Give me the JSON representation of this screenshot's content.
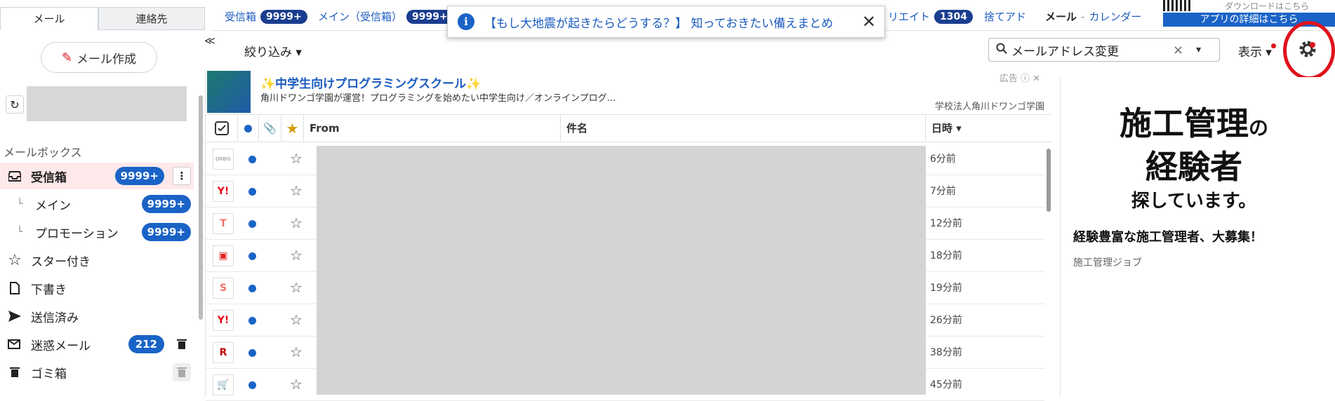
{
  "sidebar": {
    "tab_mail": "メール",
    "tab_contacts": "連絡先",
    "compose_label": "メール作成",
    "collapse_glyph": "≪",
    "mailbox_heading": "メールボックス",
    "folders": [
      {
        "label": "受信箱",
        "badge": "9999+"
      },
      {
        "label": "メイン",
        "badge": "9999+"
      },
      {
        "label": "プロモーション",
        "badge": "9999+"
      },
      {
        "label": "スター付き"
      },
      {
        "label": "下書き"
      },
      {
        "label": "送信済み"
      },
      {
        "label": "迷惑メール",
        "badge": "212"
      },
      {
        "label": "ゴミ箱"
      }
    ]
  },
  "topbar": {
    "tabs": [
      {
        "label": "受信箱",
        "badge": "9999+"
      },
      {
        "label": "メイン（受信箱）",
        "badge": "9999+"
      },
      {
        "label": "リエイト",
        "badge": "1304"
      },
      {
        "label": "捨てアド"
      }
    ],
    "app_mail": "メール",
    "app_separator": " - ",
    "app_calendar": "カレンダー",
    "app_banner": "アプリの詳細はこちら",
    "app_top_text": "ダウンロードはこちら"
  },
  "notice": {
    "text": "【もし大地震が起きたらどうする？】 知っておきたい備えまとめ",
    "close": "✕"
  },
  "toolbar": {
    "filter_label": "絞り込み ▾",
    "search_value": "メールアドレス変更",
    "search_clear": "×",
    "search_dropdown": "▾",
    "display_label": "表示 ▾"
  },
  "list": {
    "ad": {
      "title": "✨中学生向けプログラミングスクール✨",
      "description": "角川ドワンゴ学園が運営！プログラミングを始めたい中学生向け／オンラインプログ...",
      "label": "広告 ⓘ ✕",
      "sponsor": "学校法人角川ドワンゴ学園"
    },
    "columns": {
      "from": "From",
      "subject": "件名",
      "date": "日時 ▾"
    },
    "rows": [
      {
        "logo": "ORBIS",
        "logo_color": "#888888",
        "time": "6分前"
      },
      {
        "logo": "Y!",
        "logo_color": "#e60012",
        "time": "7分前"
      },
      {
        "logo": "T",
        "logo_color": "#f07070",
        "time": "12分前"
      },
      {
        "logo": "▣",
        "logo_color": "#e02020",
        "time": "18分前"
      },
      {
        "logo": "S",
        "logo_color": "#f07070",
        "time": "19分前"
      },
      {
        "logo": "Y!",
        "logo_color": "#e60012",
        "time": "26分前"
      },
      {
        "logo": "R",
        "logo_color": "#bf0000",
        "time": "38分前"
      },
      {
        "logo": "🛒",
        "logo_color": "#ff6a00",
        "time": "45分前"
      }
    ]
  },
  "right_ad": {
    "line1": "施工管理",
    "line1_particle": "の",
    "line2": "経験者",
    "line3": "探しています。",
    "headline": "経験豊富な施工管理者、大募集！",
    "sponsor": "施工管理ジョブ"
  },
  "colors": {
    "accent": "#1a63c6",
    "highlight": "#fde8ea",
    "annotation": "#e0121b"
  }
}
